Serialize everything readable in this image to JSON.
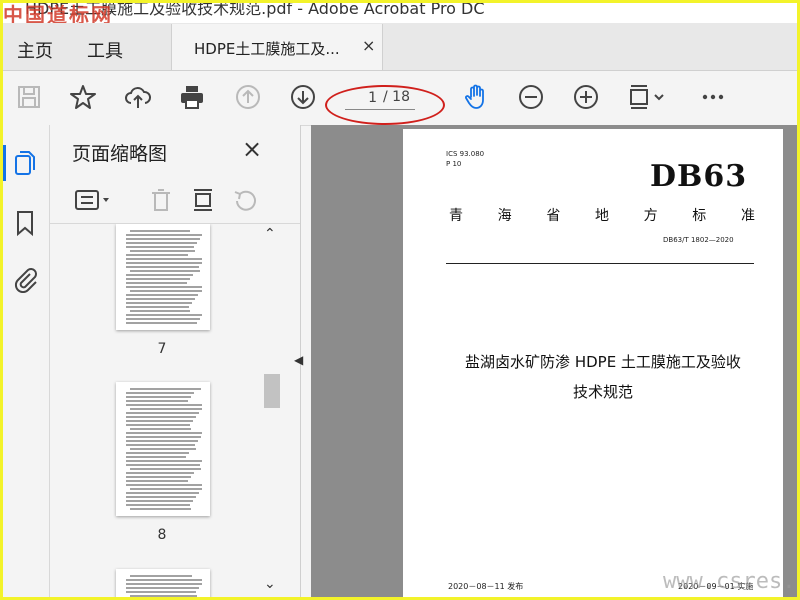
{
  "window": {
    "title": "HDPE土工膜施工及验收技术规范.pdf - Adobe Acrobat Pro DC",
    "watermark": "中国道标网"
  },
  "menu": {
    "home": "主页",
    "tools": "工具"
  },
  "tab": {
    "label": "HDPE土工膜施工及...",
    "close": "×"
  },
  "toolbar": {
    "page_current": "1",
    "page_total": "/ 18",
    "accent_color": "#1473e6"
  },
  "panel": {
    "title": "页面缩略图",
    "close": "×",
    "thumbnails": [
      {
        "label": "7"
      },
      {
        "label": "8"
      },
      {
        "label": ""
      }
    ]
  },
  "document": {
    "ics": "ICS 93.080",
    "ccs": "P 10",
    "code": "DB63",
    "standard_type_chars": [
      "青",
      "海",
      "省",
      "地",
      "方",
      "标",
      "准"
    ],
    "standard_number": "DB63/T 1802—2020",
    "title_line1": "盐湖卤水矿防渗 HDPE 土工膜施工及验收",
    "title_line2": "技术规范",
    "issue_date": "2020－08－11 发布",
    "implement_date": "2020－09－01 实施",
    "watermark": "www.csres.com"
  }
}
